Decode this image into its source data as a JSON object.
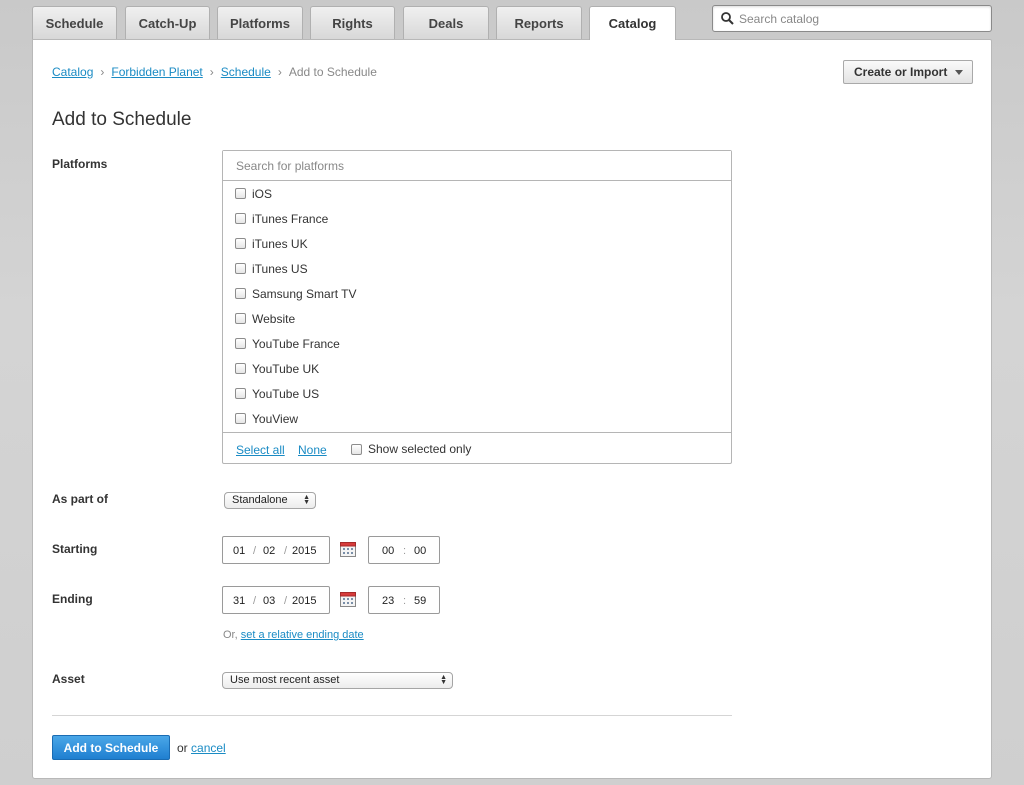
{
  "tabs": [
    {
      "label": "Schedule"
    },
    {
      "label": "Catch-Up"
    },
    {
      "label": "Platforms"
    },
    {
      "label": "Rights"
    },
    {
      "label": "Deals"
    },
    {
      "label": "Reports"
    },
    {
      "label": "Catalog",
      "active": true
    }
  ],
  "search": {
    "placeholder": "Search catalog"
  },
  "breadcrumb": {
    "items": [
      "Catalog",
      "Forbidden Planet",
      "Schedule"
    ],
    "current": "Add to Schedule",
    "separator": "›"
  },
  "create_button": {
    "label": "Create or Import"
  },
  "page_title": "Add to Schedule",
  "platforms": {
    "label": "Platforms",
    "search_placeholder": "Search for platforms",
    "items": [
      {
        "label": "iOS",
        "checked": false
      },
      {
        "label": "iTunes France",
        "checked": false
      },
      {
        "label": "iTunes UK",
        "checked": false
      },
      {
        "label": "iTunes US",
        "checked": false
      },
      {
        "label": "Samsung Smart TV",
        "checked": false
      },
      {
        "label": "Website",
        "checked": false
      },
      {
        "label": "YouTube France",
        "checked": false
      },
      {
        "label": "YouTube UK",
        "checked": false
      },
      {
        "label": "YouTube US",
        "checked": false
      },
      {
        "label": "YouView",
        "checked": false
      }
    ],
    "select_all": "Select all",
    "none": "None",
    "show_selected_only": "Show selected only"
  },
  "as_part_of": {
    "label": "As part of",
    "value": "Standalone"
  },
  "starting": {
    "label": "Starting",
    "day": "01",
    "month": "02",
    "year": "2015",
    "hour": "00",
    "minute": "00"
  },
  "ending": {
    "label": "Ending",
    "day": "31",
    "month": "03",
    "year": "2015",
    "hour": "23",
    "minute": "59"
  },
  "relative": {
    "prefix": "Or,",
    "link": "set a relative ending date"
  },
  "asset": {
    "label": "Asset",
    "value": "Use most recent asset"
  },
  "submit": {
    "label": "Add to Schedule",
    "or": "or",
    "cancel": "cancel"
  },
  "colors": {
    "link": "#1a8bc4",
    "primary_button": "#2a8ad8"
  }
}
